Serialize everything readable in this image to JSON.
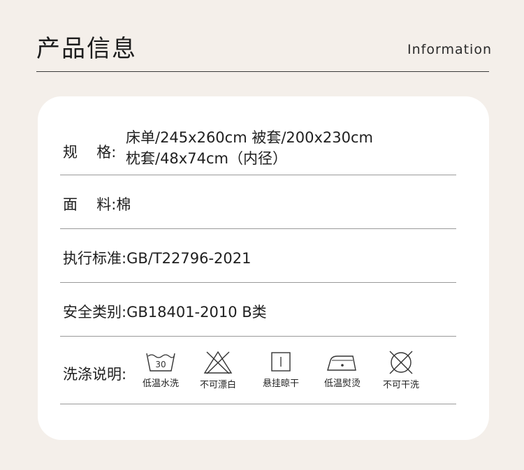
{
  "header": {
    "title": "产品信息",
    "subtitle": "Information"
  },
  "rows": {
    "spec": {
      "label_a": "规",
      "label_b": "格",
      "colon": ":",
      "line1": "床单/245x260cm 被套/200x230cm",
      "line2": "枕套/48x74cm（内径）"
    },
    "fabric": {
      "label_a": "面",
      "label_b": "料",
      "colon": ":",
      "value": "棉"
    },
    "standard": {
      "label": "执行标准",
      "colon": ":",
      "value": "GB/T22796-2021"
    },
    "safety": {
      "label": "安全类别",
      "colon": ":",
      "value": "GB18401-2010 B类"
    },
    "care": {
      "label": "洗涤说明",
      "colon": ":",
      "icons": [
        {
          "icon": "wash-30-icon",
          "number": "30",
          "label": "低温水洗"
        },
        {
          "icon": "no-bleach-icon",
          "label": "不可漂白"
        },
        {
          "icon": "hang-dry-icon",
          "label": "悬挂晾干"
        },
        {
          "icon": "low-iron-icon",
          "label": "低温熨烫"
        },
        {
          "icon": "no-dryclean-icon",
          "label": "不可干洗"
        }
      ]
    }
  }
}
